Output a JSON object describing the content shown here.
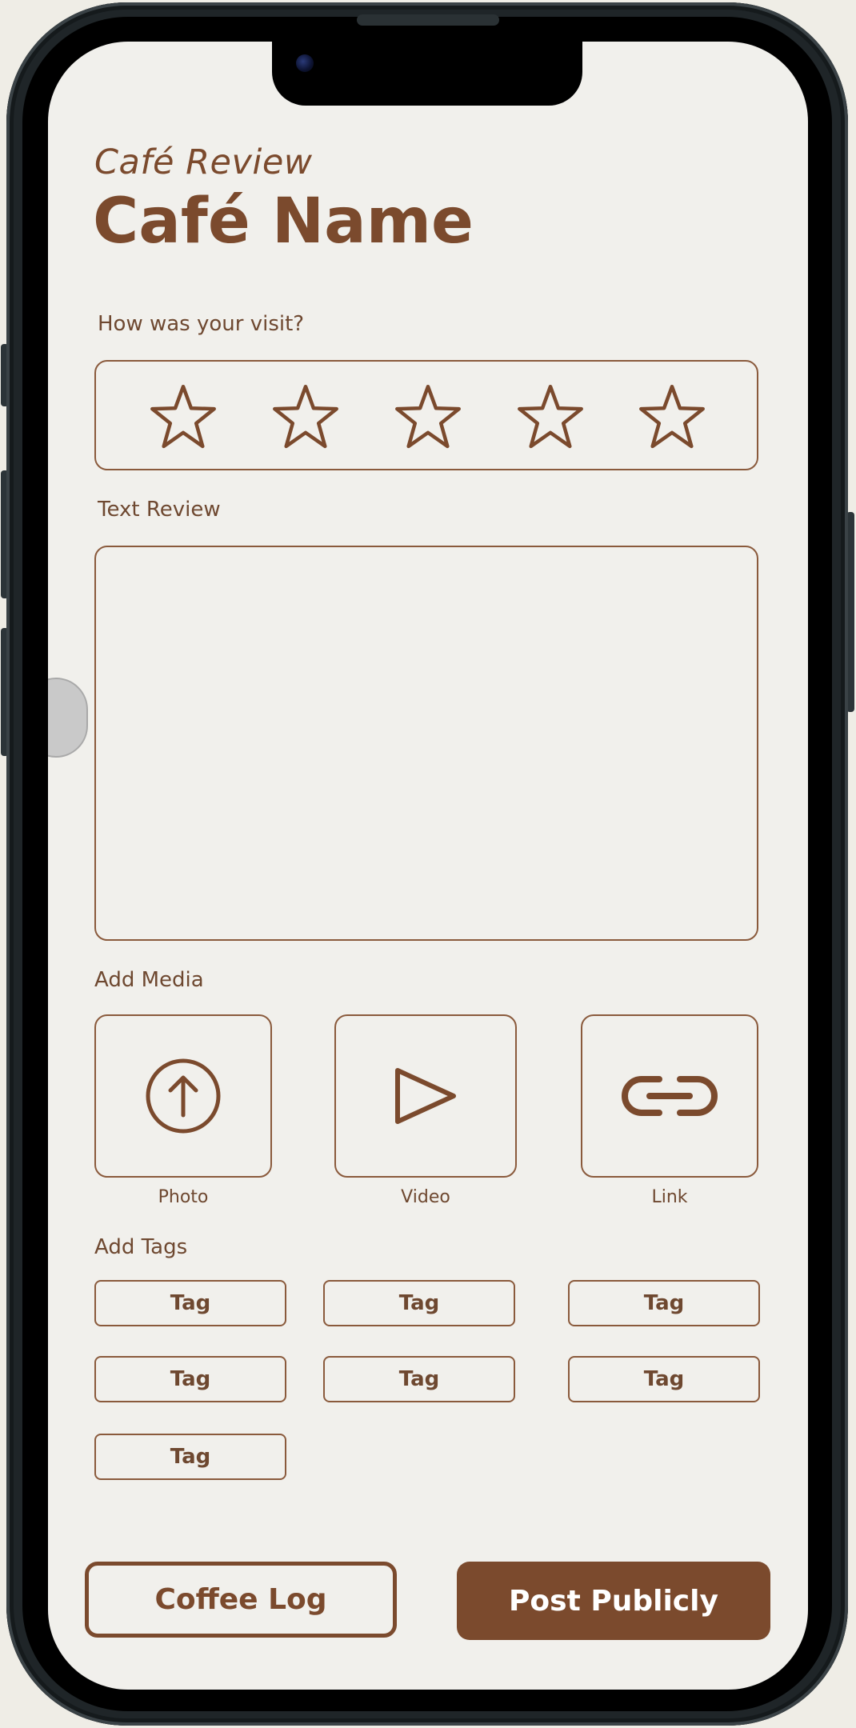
{
  "header": {
    "subtitle": "Café Review",
    "title": "Café Name"
  },
  "rating": {
    "label": "How was your visit?",
    "stars_total": 5,
    "stars_filled": 0
  },
  "review": {
    "label": "Text Review",
    "value": ""
  },
  "media": {
    "label": "Add Media",
    "items": [
      {
        "label": "Photo",
        "icon": "upload-icon"
      },
      {
        "label": "Video",
        "icon": "play-icon"
      },
      {
        "label": "Link",
        "icon": "link-icon"
      }
    ]
  },
  "tags": {
    "label": "Add Tags",
    "items": [
      "Tag",
      "Tag",
      "Tag",
      "Tag",
      "Tag",
      "Tag",
      "Tag"
    ]
  },
  "actions": {
    "secondary_label": "Coffee Log",
    "primary_label": "Post Publicly"
  },
  "colors": {
    "accent": "#7b4a2d",
    "background": "#f1f0ec"
  }
}
